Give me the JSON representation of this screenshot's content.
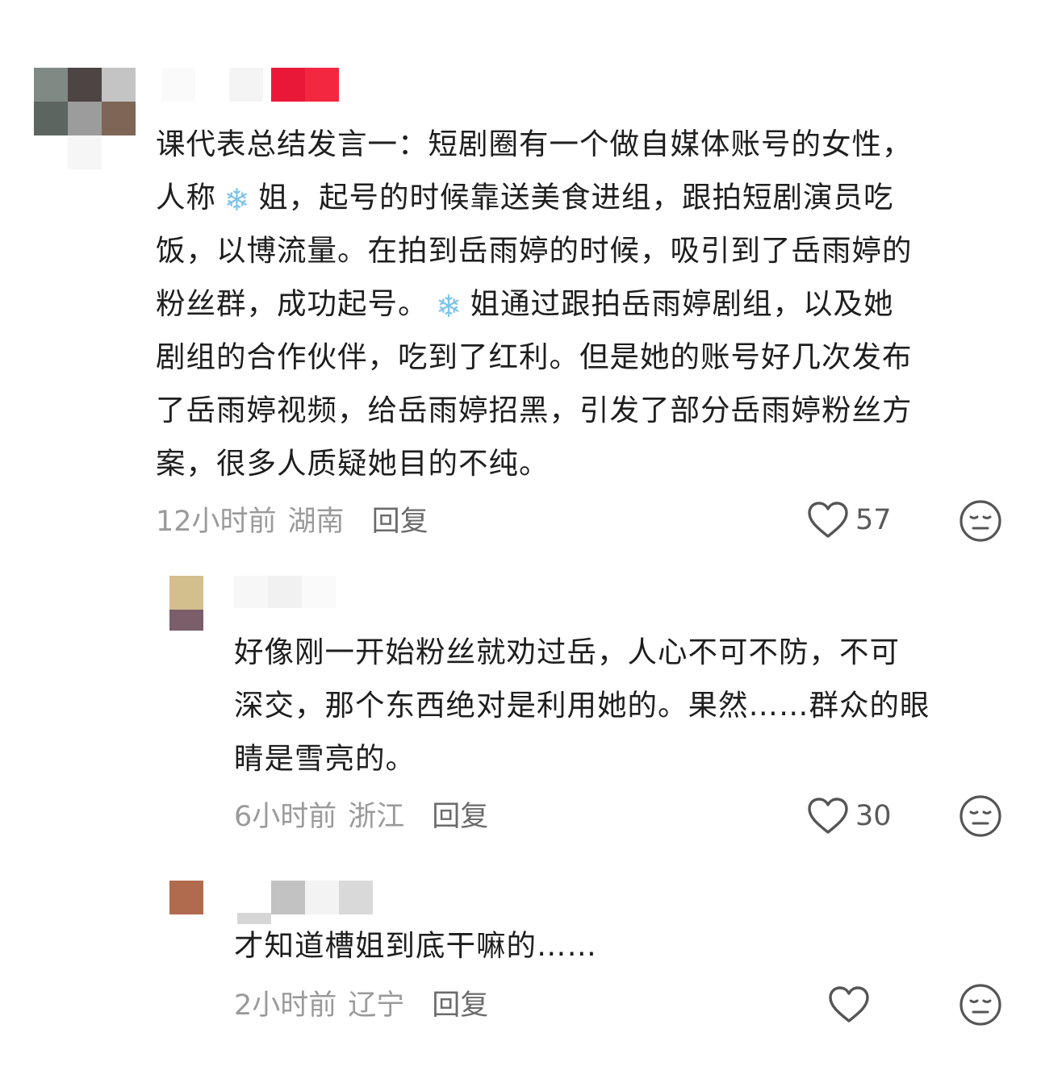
{
  "comments": [
    {
      "text_lines": [
        "课代表总结发言一：短剧圈有一个做自媒体账号的女性，",
        "人称|❄️|姐，起号的时候靠送美食进组，跟拍短剧演员吃",
        "饭，以博流量。在拍到岳雨婷的时候，吸引到了岳雨婷的",
        "粉丝群，成功起号。|❄️|姐通过跟拍岳雨婷剧组，以及她",
        "剧组的合作伙伴，吃到了红利。但是她的账号好几次发布",
        "了岳雨婷视频，给岳雨婷招黑，引发了部分岳雨婷粉丝方",
        "案，很多人质疑她目的不纯。"
      ],
      "time": "12小时前",
      "location": "湖南",
      "reply_label": "回复",
      "likes": "57"
    },
    {
      "text_lines": [
        "好像刚一开始粉丝就劝过岳，人心不可不防，不可",
        "深交，那个东西绝对是利用她的。果然……群众的眼",
        "睛是雪亮的。"
      ],
      "time": "6小时前",
      "location": "浙江",
      "reply_label": "回复",
      "likes": "30"
    },
    {
      "text_lines": [
        "才知道槽姐到底干嘛的……"
      ],
      "time": "2小时前",
      "location": "辽宁",
      "reply_label": "回复",
      "likes": ""
    }
  ],
  "icons": {
    "like": "heart-outline-icon",
    "dislike": "neutral-face-icon",
    "emoji": "snowflake-emoji"
  },
  "colors": {
    "text": "#1e1e1e",
    "meta": "#9a9a9a",
    "icon_stroke": "#555555",
    "name_badge": "#f0243a"
  }
}
